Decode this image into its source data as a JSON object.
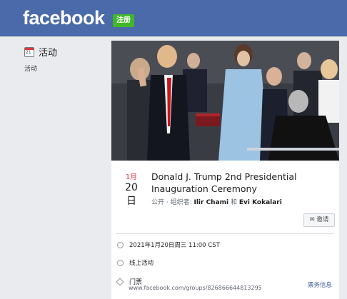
{
  "header": {
    "logo": "facebook",
    "signup_label": "注册"
  },
  "sidebar": {
    "title": "活动",
    "subtitle": "活动",
    "calendar_day": "21"
  },
  "event": {
    "month": "1月",
    "day": "20日",
    "title": "Donald J. Trump 2nd Presidential Inauguration Ceremony",
    "visibility": "公开 · 组织者: ",
    "organizer1": "Ilir Chami",
    "and": " 和 ",
    "organizer2": "Evi Kokalari",
    "share_label": "邀请",
    "datetime": "2021年1月20日周三 11:00 CST",
    "online_label": "线上活动",
    "ticket_label": "门票",
    "ticket_url": "www.facebook.com/groups/826866644813295",
    "ticket_info": "票务信息"
  },
  "colors": {
    "header_bg": "#4a6aa9",
    "signup_green": "#42b72a",
    "date_red": "#e0393e",
    "link_blue": "#385898"
  }
}
